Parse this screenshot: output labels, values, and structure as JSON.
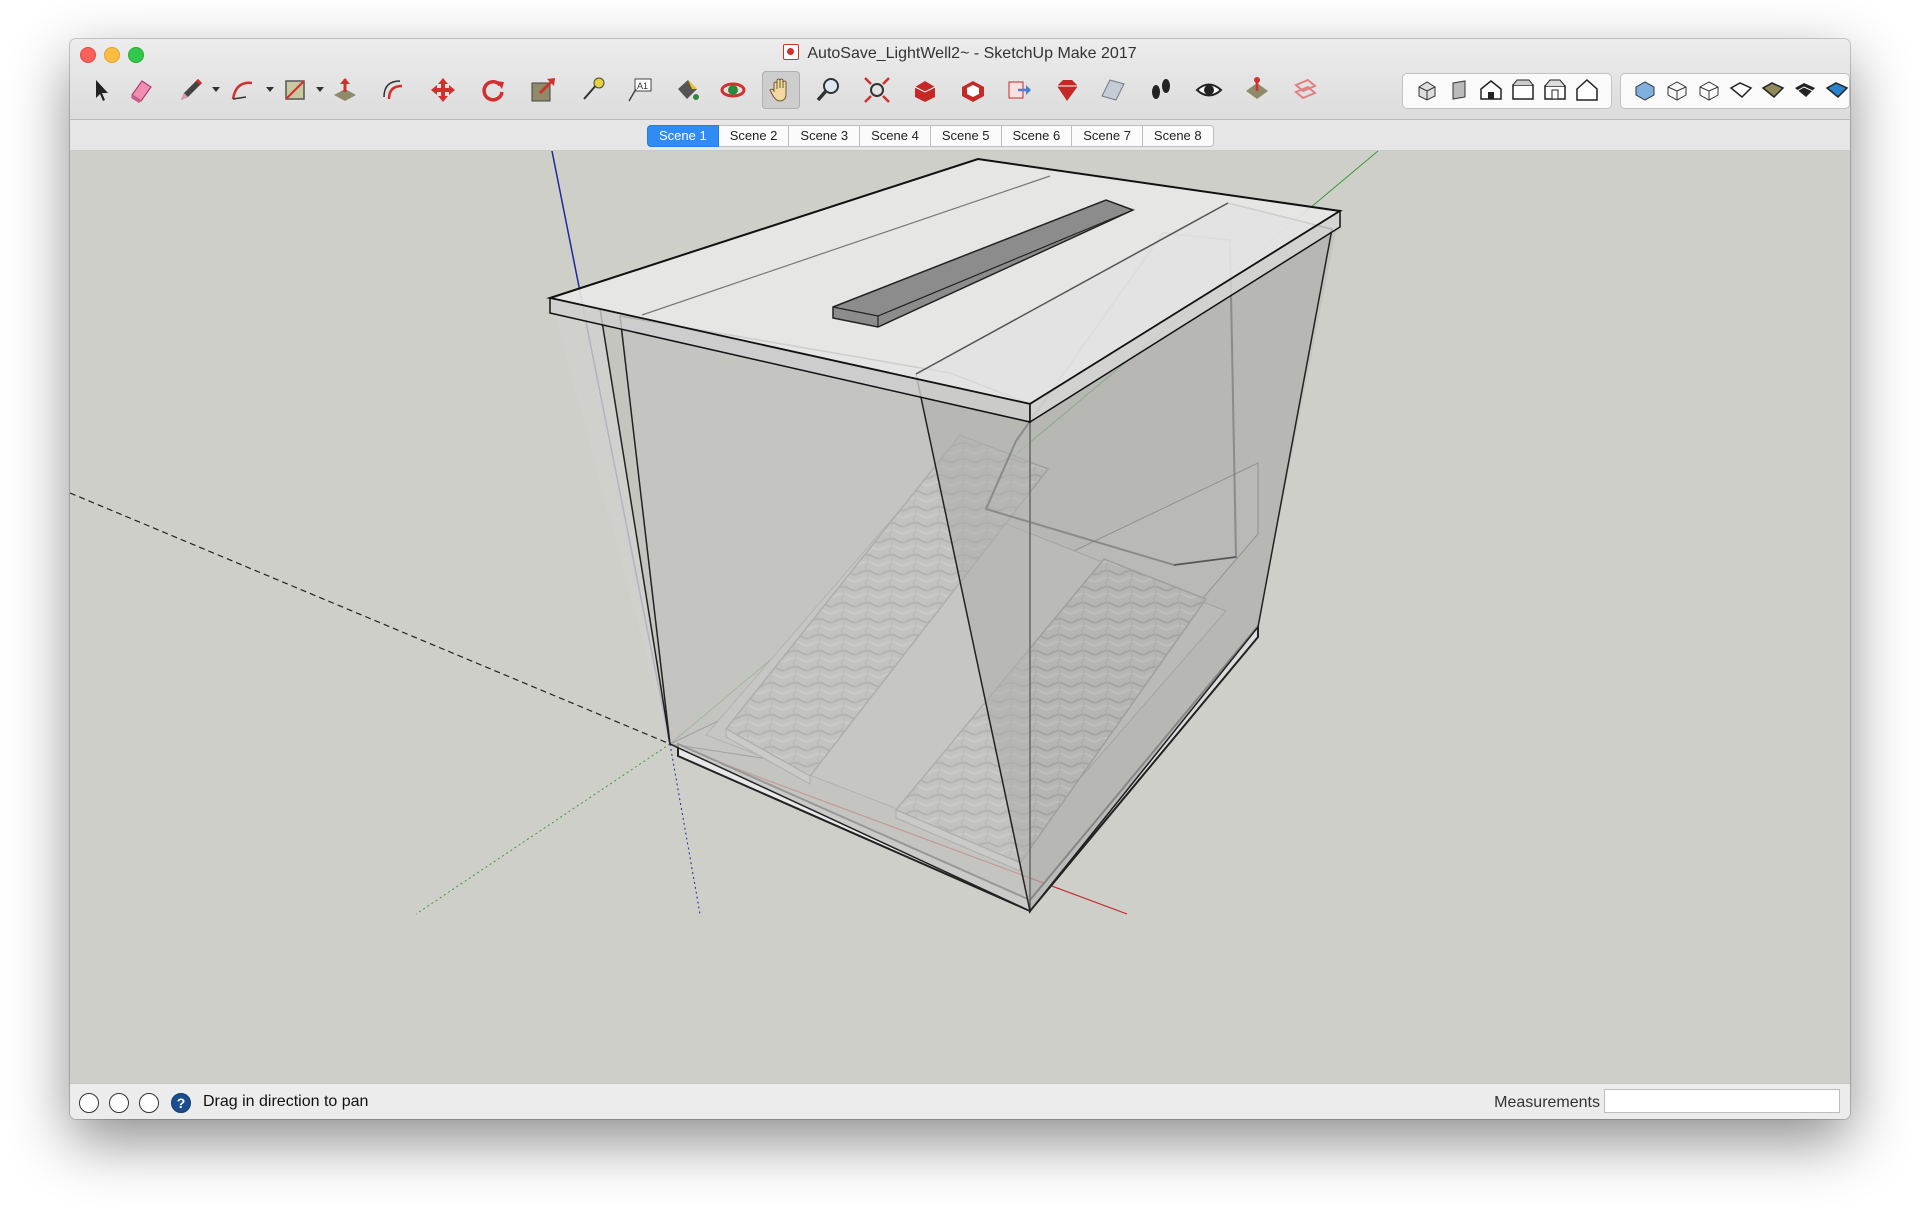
{
  "window": {
    "title": "AutoSave_LightWell2~ - SketchUp Make 2017"
  },
  "toolbar": {
    "tools": [
      {
        "name": "select-tool",
        "icon": "arrow-cursor-icon"
      },
      {
        "name": "eraser-tool",
        "icon": "eraser-icon"
      },
      {
        "name": "line-tool",
        "icon": "pencil-icon"
      },
      {
        "name": "arc-tool",
        "icon": "arc-icon"
      },
      {
        "name": "rectangle-tool",
        "icon": "rectangle-icon"
      },
      {
        "name": "push-pull-tool",
        "icon": "push-pull-icon"
      },
      {
        "name": "offset-tool",
        "icon": "offset-icon"
      },
      {
        "name": "move-tool",
        "icon": "move-arrows-icon"
      },
      {
        "name": "rotate-tool",
        "icon": "rotate-icon"
      },
      {
        "name": "scale-tool",
        "icon": "scale-icon"
      },
      {
        "name": "tape-measure-tool",
        "icon": "tape-measure-icon"
      },
      {
        "name": "text-tool",
        "icon": "text-icon"
      },
      {
        "name": "paint-bucket-tool",
        "icon": "paint-bucket-icon"
      },
      {
        "name": "orbit-tool",
        "icon": "orbit-icon"
      },
      {
        "name": "pan-tool",
        "icon": "hand-icon"
      },
      {
        "name": "zoom-tool",
        "icon": "magnifier-icon"
      },
      {
        "name": "zoom-extents-tool",
        "icon": "zoom-extents-icon"
      },
      {
        "name": "warehouse-tool",
        "icon": "warehouse-icon"
      },
      {
        "name": "share-model-tool",
        "icon": "share-model-icon"
      },
      {
        "name": "share-component-tool",
        "icon": "share-component-icon"
      },
      {
        "name": "extension-warehouse-tool",
        "icon": "ruby-icon"
      },
      {
        "name": "layout-tool",
        "icon": "layout-icon"
      },
      {
        "name": "walk-tool",
        "icon": "footprints-icon"
      },
      {
        "name": "look-around-tool",
        "icon": "eye-icon"
      },
      {
        "name": "position-camera-tool",
        "icon": "position-camera-icon"
      },
      {
        "name": "section-tool",
        "icon": "section-plane-icon"
      }
    ],
    "views": [
      "iso-view-icon",
      "top-view-icon",
      "front-view-icon",
      "right-view-icon",
      "back-view-icon",
      "left-view-icon"
    ],
    "styles": [
      "xray-style-icon",
      "wireframe-style-icon",
      "hidden-line-style-icon",
      "shaded-style-icon",
      "textured-style-icon",
      "monochrome-style-icon"
    ],
    "accent": "#d32f2f"
  },
  "scenes": {
    "tabs": [
      "Scene 1",
      "Scene 2",
      "Scene 3",
      "Scene 4",
      "Scene 5",
      "Scene 6",
      "Scene 7",
      "Scene 8"
    ],
    "active": "Scene 1",
    "active_color": "#2f8cf5"
  },
  "status": {
    "message": "Drag in direction to pan",
    "measurements_label": "Measurements",
    "measurements_value": ""
  }
}
